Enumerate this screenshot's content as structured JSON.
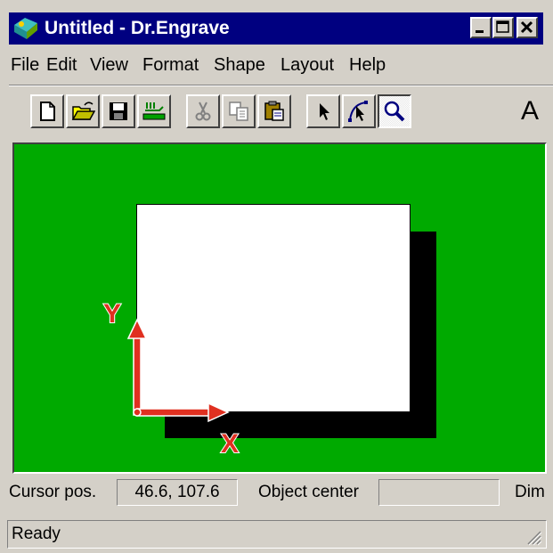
{
  "window": {
    "title": "Untitled - Dr.Engrave",
    "app_icon": "dr-engrave-app-icon",
    "caption_buttons": [
      "minimize",
      "maximize",
      "close"
    ]
  },
  "menu": {
    "items": [
      {
        "label": "File"
      },
      {
        "label": "Edit"
      },
      {
        "label": "View"
      },
      {
        "label": "Format"
      },
      {
        "label": "Shape"
      },
      {
        "label": "Layout"
      },
      {
        "label": "Help"
      }
    ]
  },
  "toolbar": {
    "buttons": [
      {
        "icon": "new-file-icon"
      },
      {
        "icon": "open-folder-icon"
      },
      {
        "icon": "save-disk-icon"
      },
      {
        "icon": "import-scan-icon"
      },
      {
        "icon": "cut-scissors-icon",
        "disabled": true
      },
      {
        "icon": "copy-icon",
        "disabled": true
      },
      {
        "icon": "paste-clipboard-icon"
      },
      {
        "icon": "select-arrow-icon"
      },
      {
        "icon": "node-edit-icon"
      },
      {
        "icon": "zoom-magnifier-icon",
        "pressed": true
      }
    ],
    "text_tool_label": "A"
  },
  "canvas": {
    "background": "#00aa00",
    "axis_color": "#e03020",
    "y_axis_label": "Y",
    "x_axis_label": "X"
  },
  "status": {
    "cursor_label": "Cursor pos.",
    "cursor_value": "46.6, 107.6",
    "center_label": "Object center",
    "center_value": "",
    "dim_label": "Dim",
    "ready_text": "Ready"
  }
}
